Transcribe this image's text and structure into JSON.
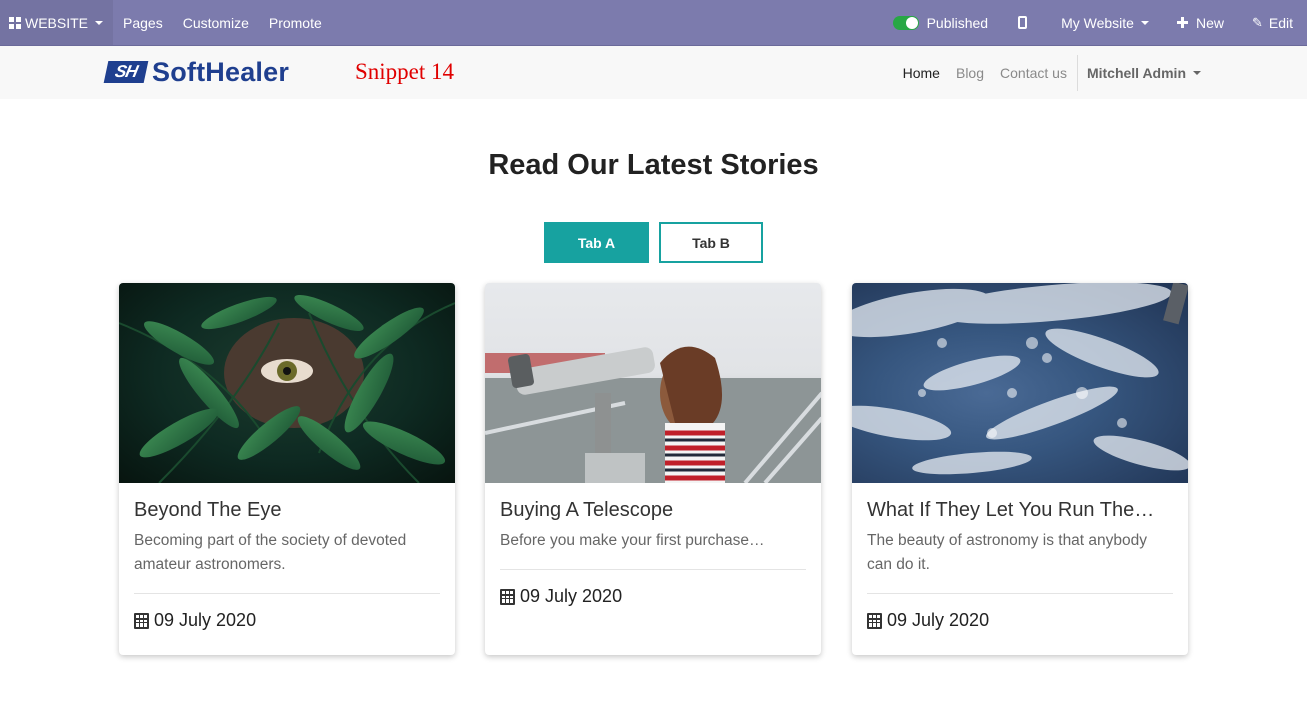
{
  "admin_bar": {
    "website_label": "WEBSITE",
    "pages_label": "Pages",
    "customize_label": "Customize",
    "promote_label": "Promote",
    "published_label": "Published",
    "my_website_label": "My Website",
    "new_label": "New",
    "edit_label": "Edit",
    "bar_color": "#7c7bad"
  },
  "header": {
    "logo_mark": "SH",
    "logo_text": "SoftHealer",
    "snippet_label": "Snippet 14",
    "nav": {
      "home": "Home",
      "blog": "Blog",
      "contact": "Contact us"
    },
    "user_label": "Mitchell Admin"
  },
  "main": {
    "heading": "Read Our Latest Stories",
    "tabs": [
      {
        "label": "Tab A",
        "active": true
      },
      {
        "label": "Tab B",
        "active": false
      }
    ],
    "accent_color": "#17a2a0",
    "cards": [
      {
        "title": "Beyond The Eye",
        "description": "Becoming part of the society of devoted amateur astronomers.",
        "date": "09 July 2020"
      },
      {
        "title": "Buying A Telescope",
        "description": "Before you make your first purchase…",
        "date": "09 July 2020"
      },
      {
        "title": "What If They Let You Run The…",
        "description": "The beauty of astronomy is that anybody can do it.",
        "date": "09 July 2020"
      }
    ]
  }
}
